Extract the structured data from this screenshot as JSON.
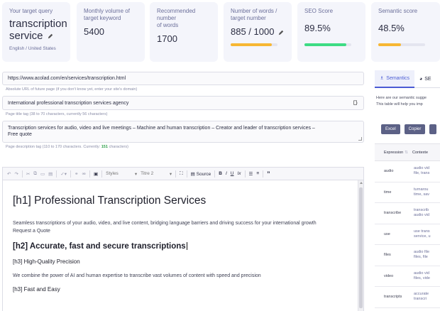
{
  "cards": {
    "target_query": {
      "label": "Your target query",
      "value_line1": "transcription",
      "value_line2": "service",
      "locale": "English / United States"
    },
    "monthly_volume": {
      "label_line1": "Monthly volume of",
      "label_line2": "target keyword",
      "value": "5400"
    },
    "recommended_words": {
      "label_line1": "Recommended number",
      "label_line2": "of words",
      "value": "1700"
    },
    "word_count": {
      "label_line1": "Number of words /",
      "label_line2": "target number",
      "value": "885 / 1000",
      "progress": 0.885,
      "color": "#f7b733"
    },
    "seo_score": {
      "label": "SEO Score",
      "value": "89.5%",
      "progress": 0.895,
      "color": "#3ddc84"
    },
    "semantic_score": {
      "label": "Semantic score",
      "value": "48.5%",
      "progress": 0.485,
      "color": "#f7b733"
    }
  },
  "form": {
    "url_value": "https://www.acolad.com/en/services/transcription.html",
    "url_help": "Absolute URL of future page (if you don't know yet, enter your site's domain)",
    "title_value": "International professional transcription services agency",
    "title_help_prefix": "Page title tag (38 to 70 characters, currently ",
    "title_help_count": "56",
    "title_help_suffix": " characters)",
    "desc_value_line1": "Transcription services for audio, video and live meetings – Machine and human transcription – Creator and leader of transcription services –",
    "desc_value_line2": "Free quote",
    "desc_help_prefix": "Page description tag (110 to 170 characters. Currently: ",
    "desc_help_count": "151",
    "desc_help_suffix": " characters)"
  },
  "toolbar": {
    "styles_label": "Styles",
    "heading_label": "Titre 2",
    "source_label": "Source",
    "bold": "B",
    "italic": "I",
    "underline": "U",
    "clear_format": "Ix",
    "quote": "”"
  },
  "editor": {
    "h1": "[h1] Professional Transcription Services",
    "para1": "Seamless transcriptions of your audio, video, and live content, bridging language barriers and driving success for your international growth Request a Quote",
    "h2": "[h2] Accurate, fast and secure transcriptions",
    "h3a": "[h3] High-Quality Precision",
    "para2": "We combine the power of AI and human expertise to transcribe vast volumes of content with speed and precision",
    "h3b": "[h3] Fast and Easy"
  },
  "right_panel": {
    "tab_semantics": "Semantics",
    "tab_seo": "SE",
    "intro_line1": "Here are our semantic sugge",
    "intro_line2": "This table will help you imp",
    "btn_excel": "Excel",
    "btn_copy": "Copier",
    "col_expression": "Expression",
    "col_context": "Contexte",
    "rows": [
      {
        "expression": "audio",
        "context_line1": "audio vid",
        "context_line2": "file, trans"
      },
      {
        "expression": "time",
        "context_line1": "turnarou",
        "context_line2": "time, sav"
      },
      {
        "expression": "transcribe",
        "context_line1": "transcrib",
        "context_line2": "audio vid"
      },
      {
        "expression": "use",
        "context_line1": "use trans",
        "context_line2": "service, u"
      },
      {
        "expression": "files",
        "context_line1": "audio file",
        "context_line2": "files, file"
      },
      {
        "expression": "video",
        "context_line1": "audio vid",
        "context_line2": "files, vide"
      },
      {
        "expression": "transcripts",
        "context_line1": "accurate",
        "context_line2": "transcri"
      }
    ]
  },
  "colors": {
    "accent": "#4a5bd4",
    "card_bg": "#f4f5fb",
    "button": "#5c6186",
    "success": "#3ddc84",
    "warning": "#f7b733"
  },
  "icons": [
    "pencil-icon",
    "copy-paste-icon",
    "sort-icon",
    "semantics-icon",
    "seo-icon"
  ]
}
